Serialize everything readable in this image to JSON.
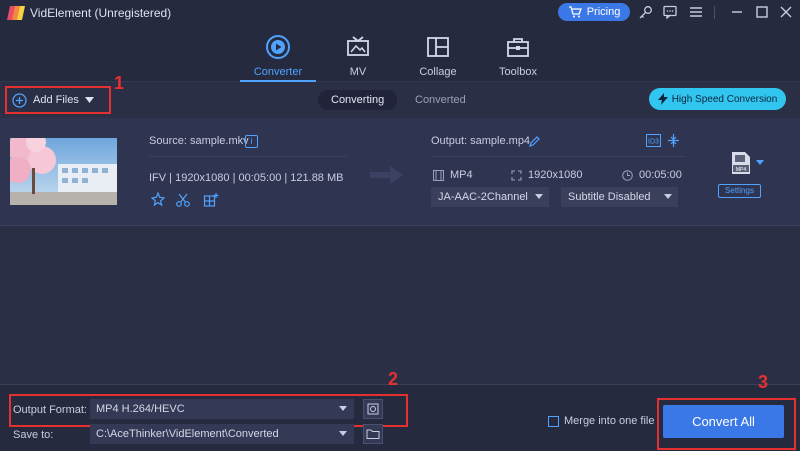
{
  "titlebar": {
    "app_title": "VidElement (Unregistered)",
    "pricing_label": "Pricing"
  },
  "tabs": [
    {
      "label": "Converter",
      "active": true,
      "icon": "converter-icon"
    },
    {
      "label": "MV",
      "active": false,
      "icon": "mv-icon"
    },
    {
      "label": "Collage",
      "active": false,
      "icon": "collage-icon"
    },
    {
      "label": "Toolbox",
      "active": false,
      "icon": "toolbox-icon"
    }
  ],
  "toolbar": {
    "add_files_label": "Add Files",
    "segment_converting": "Converting",
    "segment_converted": "Converted",
    "high_speed_label": "High Speed Conversion"
  },
  "annotations": {
    "step1": "1",
    "step2": "2",
    "step3": "3"
  },
  "file": {
    "source_label": "Source: sample.mkv",
    "meta": "IFV | 1920x1080 | 00:05:00 | 121.88 MB",
    "output_label": "Output: sample.mp4",
    "out_format": "MP4",
    "out_resolution": "1920x1080",
    "out_duration": "00:05:00",
    "audio_track": "JA-AAC-2Channel",
    "subtitle": "Subtitle Disabled",
    "format_badge": "MP4",
    "settings_label": "Settings"
  },
  "bottom": {
    "output_format_label": "Output Format:",
    "output_format_value": "MP4 H.264/HEVC",
    "save_to_label": "Save to:",
    "save_to_value": "C:\\AceThinker\\VidElement\\Converted",
    "merge_label": "Merge into one file",
    "convert_all_label": "Convert All"
  },
  "colors": {
    "accent": "#3a78e8",
    "highlight": "#e53030",
    "cyan": "#30c6f0",
    "bg": "#2b2f45"
  }
}
